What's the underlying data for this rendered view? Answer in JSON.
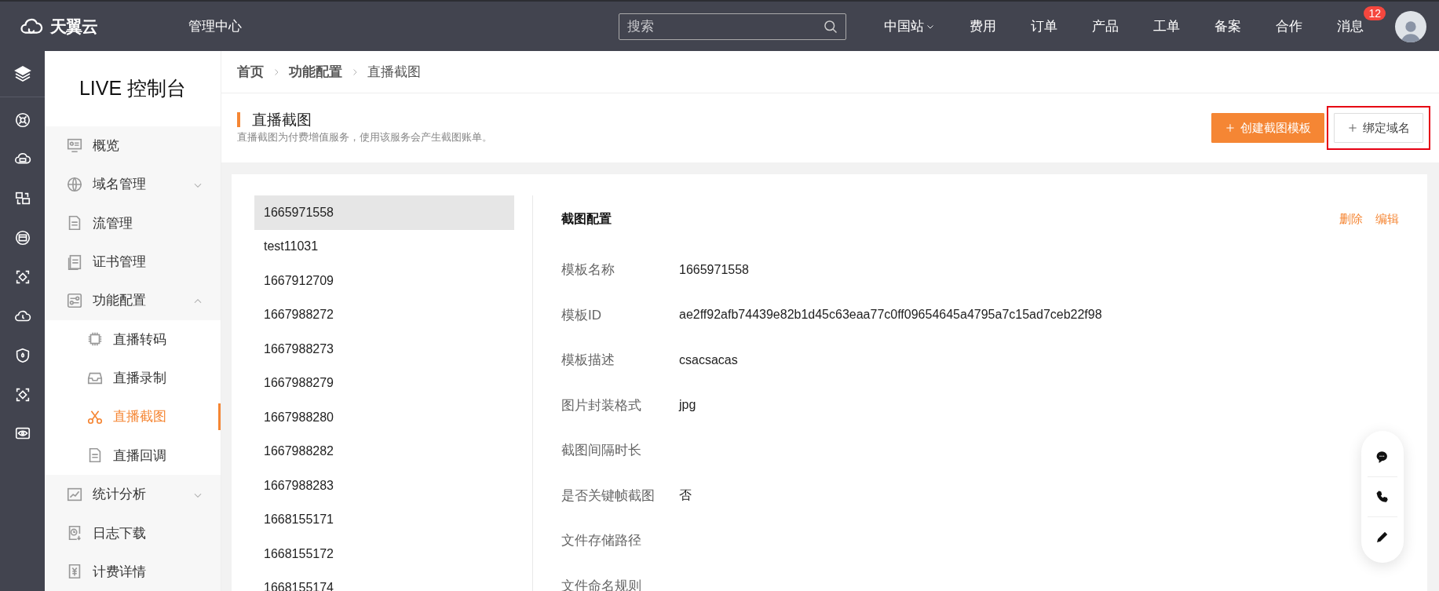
{
  "top_bar": {
    "logo": "天翼云",
    "title": "管理中心",
    "search": {
      "placeholder": "搜索"
    },
    "nav": [
      {
        "label": "中国站",
        "has_dropdown": true
      },
      {
        "label": "费用",
        "has_dropdown": false
      },
      {
        "label": "订单",
        "has_dropdown": false
      },
      {
        "label": "产品",
        "has_dropdown": false
      },
      {
        "label": "工单",
        "has_dropdown": false
      },
      {
        "label": "备案",
        "has_dropdown": false
      },
      {
        "label": "合作",
        "has_dropdown": false
      }
    ],
    "messages": {
      "label": "消息",
      "badge": "12"
    }
  },
  "sidebar": {
    "title": "LIVE 控制台",
    "items": [
      {
        "label": "概览",
        "selected": false
      },
      {
        "label": "域名管理",
        "selected": false,
        "expanded": false
      },
      {
        "label": "流管理",
        "selected": false
      },
      {
        "label": "证书管理",
        "selected": false
      },
      {
        "label": "功能配置",
        "selected": false,
        "expanded": true,
        "children": [
          {
            "label": "直播转码",
            "selected": false
          },
          {
            "label": "直播录制",
            "selected": false
          },
          {
            "label": "直播截图",
            "selected": true
          },
          {
            "label": "直播回调",
            "selected": false
          }
        ]
      },
      {
        "label": "统计分析",
        "selected": false,
        "expanded": false
      },
      {
        "label": "日志下载",
        "selected": false
      },
      {
        "label": "计费详情",
        "selected": false
      }
    ]
  },
  "breadcrumb": [
    "首页",
    "功能配置",
    "直播截图"
  ],
  "page_header": {
    "title": "直播截图",
    "description": "直播截图为付费增值服务，使用该服务会产生截图账单。",
    "buttons": [
      {
        "label": "创建截图模板",
        "kind": "primary",
        "highlighted": false
      },
      {
        "label": "绑定域名",
        "kind": "default",
        "highlighted": true
      }
    ]
  },
  "template_list": [
    {
      "label": "1665971558",
      "selected": true
    },
    {
      "label": "test11031",
      "selected": false
    },
    {
      "label": "1667912709",
      "selected": false
    },
    {
      "label": "1667988272",
      "selected": false
    },
    {
      "label": "1667988273",
      "selected": false
    },
    {
      "label": "1667988279",
      "selected": false
    },
    {
      "label": "1667988280",
      "selected": false
    },
    {
      "label": "1667988282",
      "selected": false
    },
    {
      "label": "1667988283",
      "selected": false
    },
    {
      "label": "1668155171",
      "selected": false
    },
    {
      "label": "1668155172",
      "selected": false
    },
    {
      "label": "1668155174",
      "selected": false
    }
  ],
  "detail": {
    "title": "截图配置",
    "actions": [
      "删除",
      "编辑"
    ],
    "fields": [
      {
        "label": "模板名称",
        "value": "1665971558"
      },
      {
        "label": "模板ID",
        "value": "ae2ff92afb74439e82b1d45c63eaa77c0ff09654645a4795a7c15ad7ceb22f98"
      },
      {
        "label": "模板描述",
        "value": "csacsacas"
      },
      {
        "label": "图片封装格式",
        "value": "jpg"
      },
      {
        "label": "截图间隔时长"
      },
      {
        "label": "是否关键帧截图",
        "value": "否"
      },
      {
        "label": "文件存储路径"
      },
      {
        "label": "文件命名规则"
      }
    ]
  }
}
